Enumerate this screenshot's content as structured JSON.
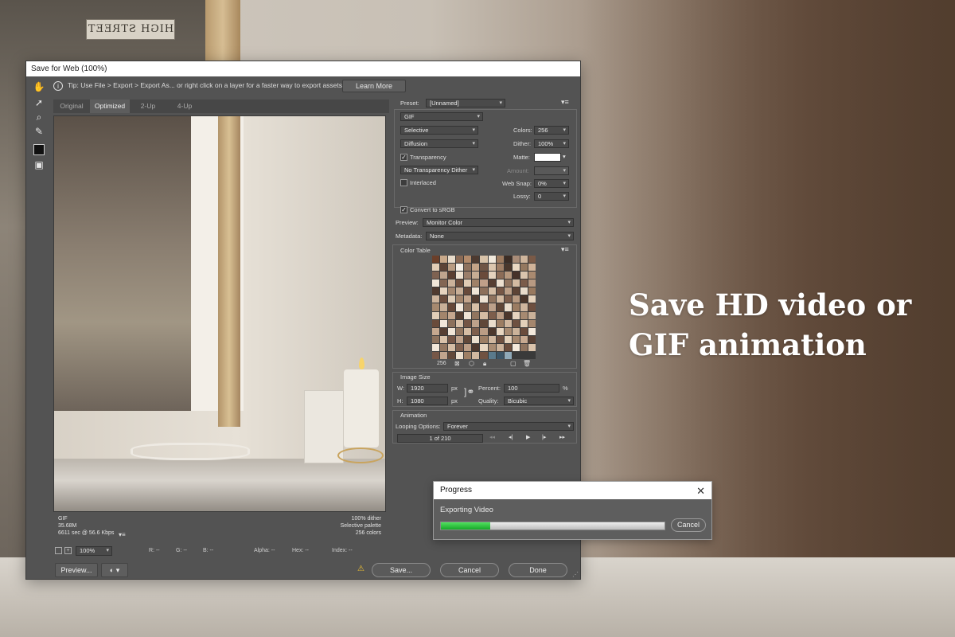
{
  "background": {
    "street_sign": "HIGH STREET",
    "headline_line1": "Save HD video or",
    "headline_line2": "GIF animation"
  },
  "dialog": {
    "title": "Save for Web (100%)",
    "tip_text": "Tip: Use File > Export > Export As...  or right click on a layer for a faster way to export assets",
    "learn_more": "Learn More",
    "tabs": [
      "Original",
      "Optimized",
      "2-Up",
      "4-Up"
    ],
    "active_tab": "Optimized",
    "image_info": {
      "format": "GIF",
      "size": "35.68M",
      "time": "6611 sec @ 56.6 Kbps",
      "dither": "100% dither",
      "palette": "Selective palette",
      "colors": "256 colors"
    },
    "status": {
      "zoom": "100%",
      "r": "R: --",
      "g": "G: --",
      "b": "B: --",
      "alpha": "Alpha: --",
      "hex": "Hex: --",
      "index": "Index: --"
    },
    "buttons": {
      "preview": "Preview...",
      "save": "Save...",
      "cancel": "Cancel",
      "done": "Done"
    }
  },
  "settings": {
    "preset_label": "Preset:",
    "preset_value": "[Unnamed]",
    "format": "GIF",
    "reduction": "Selective",
    "dither_algo": "Diffusion",
    "transparency_label": "Transparency",
    "transparency_checked": true,
    "transparency_dither": "No Transparency Dither",
    "interlaced_label": "Interlaced",
    "interlaced_checked": false,
    "colors_label": "Colors:",
    "colors_value": "256",
    "dither_label": "Dither:",
    "dither_value": "100%",
    "matte_label": "Matte:",
    "amount_label": "Amount:",
    "websnap_label": "Web Snap:",
    "websnap_value": "0%",
    "lossy_label": "Lossy:",
    "lossy_value": "0",
    "convert_srgb_label": "Convert to sRGB",
    "convert_srgb_checked": true,
    "preview_label": "Preview:",
    "preview_value": "Monitor Color",
    "metadata_label": "Metadata:",
    "metadata_value": "None"
  },
  "color_table": {
    "title": "Color Table",
    "count": "256",
    "colors": [
      "#6b3f2a",
      "#c9a98a",
      "#e8dccb",
      "#8a6a55",
      "#b38b6b",
      "#4d3a30",
      "#d7c2a8",
      "#f1e9dc",
      "#9d7b60",
      "#3c2d25",
      "#a88c78",
      "#ceb59c",
      "#7a5a47",
      "#e1cdb6",
      "#5c4336",
      "#b99c82",
      "#f5efe6",
      "#8e725e",
      "#c3a387",
      "#6f5544",
      "#dcc7af",
      "#a07f66",
      "#4a372c",
      "#ead9c4",
      "#94785f",
      "#d0b399",
      "#7e6251",
      "#bfa58e",
      "#5a3f31",
      "#efe3d2",
      "#9a7e6a",
      "#c6ad94",
      "#6a4b3a",
      "#e4d3be",
      "#8b6c57",
      "#b5977d",
      "#463229",
      "#d9c4ad",
      "#a98a70",
      "#f2e7d8",
      "#836653",
      "#cbb29a",
      "#70513f",
      "#e0cbb3",
      "#9f8168",
      "#c0a089",
      "#573f33",
      "#ecdfcf",
      "#91745f",
      "#d3bba2",
      "#7b5c4a",
      "#b89a82",
      "#4f3a2f",
      "#e6d4bf",
      "#a58870",
      "#c8af97",
      "#684a3a",
      "#f0e5d6",
      "#8d705b",
      "#d5bea6",
      "#765746",
      "#bc9f87",
      "#5d4436",
      "#e9dccb",
      "#98795f",
      "#cdb49c",
      "#6c4e3e",
      "#deccb6",
      "#a2846b",
      "#c4a68d",
      "#533d31",
      "#eee2d3",
      "#8f735e",
      "#d2b9a0",
      "#7c5d4b",
      "#b79981",
      "#4b362b",
      "#e5d2bc",
      "#a6896f",
      "#c9b098",
      "#664838",
      "#f3eadd",
      "#89705c",
      "#d6bfa7",
      "#735444",
      "#bda18a",
      "#5f4637",
      "#ebdecd",
      "#9b7c62",
      "#ceb59d",
      "#6d4f3f",
      "#e2cfb8",
      "#a3856c",
      "#c5a78e",
      "#553f32",
      "#efe4d5",
      "#91755f",
      "#d4bca3",
      "#7d5e4c",
      "#ba9c84",
      "#4c372c",
      "#e7d5c0",
      "#a78a71",
      "#cab199",
      "#694b3b",
      "#f1e7da",
      "#8c715c",
      "#d8c1a9",
      "#745545",
      "#bea28b",
      "#604738",
      "#eaddcc",
      "#9c7d63",
      "#cfb69e",
      "#6e5040",
      "#e3d0b9",
      "#a4866d",
      "#c6a88f",
      "#563f33",
      "#f0e5d7",
      "#927660",
      "#d5bda4",
      "#7e5f4d",
      "#bb9d85",
      "#4d382d",
      "#e8d6c1",
      "#a88b72",
      "#cbb29a",
      "#6a4c3c",
      "#f2e8db",
      "#8d725d",
      "#d9c2aa",
      "#755646",
      "#bfa38c",
      "#614839",
      "#ebdfce",
      "#9d7e64",
      "#d0b79f",
      "#6f5141",
      "#e4d1ba",
      "#a5876e",
      "#c7a990",
      "#574034",
      "#f1e6d8",
      "#937761",
      "#d6bea5",
      "#7f604e",
      "#bc9e86",
      "#4e392e",
      "#e9d7c2",
      "#a98c73",
      "#ccb39b",
      "#6b4d3d",
      "#f3e9dc",
      "#8e735e",
      "#dac3ab",
      "#765747",
      "#c0a48d",
      "#62493a",
      "#ece0cf",
      "#9e7f65",
      "#d1b8a0",
      "#705242",
      "#5a7a8c",
      "#3c5566",
      "#8fa9b8"
    ]
  },
  "image_size": {
    "title": "Image Size",
    "w_label": "W:",
    "w_value": "1920",
    "h_label": "H:",
    "h_value": "1080",
    "unit": "px",
    "percent_label": "Percent:",
    "percent_value": "100",
    "percent_unit": "%",
    "quality_label": "Quality:",
    "quality_value": "Bicubic"
  },
  "animation": {
    "title": "Animation",
    "looping_label": "Looping Options:",
    "looping_value": "Forever",
    "frame_counter": "1 of 210"
  },
  "progress": {
    "title": "Progress",
    "status": "Exporting Video",
    "cancel": "Cancel",
    "fraction": 0.22
  },
  "colors": {
    "progress_green": "#17a829",
    "panel_bg": "#535353"
  }
}
